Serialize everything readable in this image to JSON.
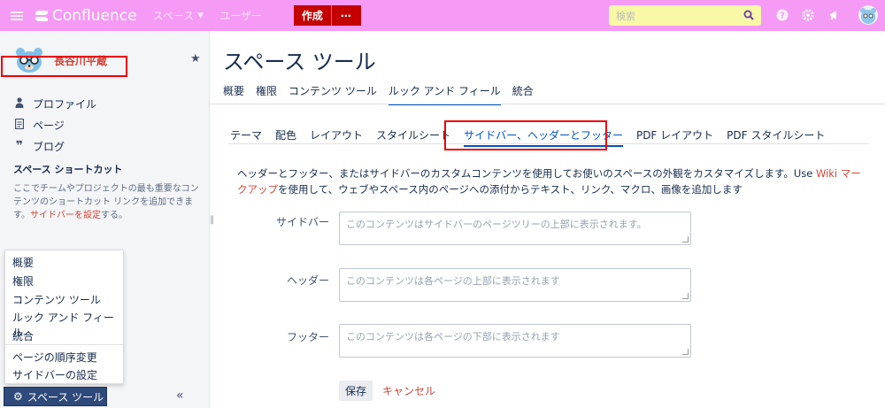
{
  "header": {
    "logo_text": "Confluence",
    "nav_spaces": "スペース",
    "nav_users": "ユーザー",
    "create_label": "作成",
    "more_label": "⋯",
    "search_placeholder": "検索",
    "colors": {
      "bar": "#f59af5",
      "create": "#c40000",
      "search_bg": "#f8f8a6"
    }
  },
  "sidebar": {
    "space_name": "長谷川平蔵",
    "links": [
      {
        "label": "プロファイル",
        "icon": "person-icon"
      },
      {
        "label": "ページ",
        "icon": "page-icon"
      },
      {
        "label": "ブログ",
        "icon": "quote-icon"
      }
    ],
    "shortcut_title": "スペース ショートカット",
    "shortcut_text_1": "ここでチームやプロジェクトの最も重要なコンテンツのショートカット リンクを追加できます。",
    "shortcut_link": "サイドバーを設定",
    "shortcut_text_2": "する。",
    "tool_button": "スペース ツール",
    "collapse_label": "«"
  },
  "popup": {
    "items": [
      "概要",
      "権限",
      "コンテンツ ツール",
      "ルック アンド フィール",
      "統合"
    ],
    "items2": [
      "ページの順序変更",
      "サイドバーの設定"
    ]
  },
  "main": {
    "title": "スペース ツール",
    "tabs": [
      "概要",
      "権限",
      "コンテンツ ツール",
      "ルック アンド フィール",
      "統合"
    ],
    "subtabs": [
      "テーマ",
      "配色",
      "レイアウト",
      "スタイルシート",
      "サイドバー、ヘッダーとフッター",
      "PDF レイアウト",
      "PDF スタイルシート"
    ],
    "desc_1": "ヘッダーとフッター、またはサイドバーのカスタムコンテンツを使用してお使いのスペースの外観をカスタマイズします。Use ",
    "desc_link": "Wiki マークアップ",
    "desc_2": "を使用して、ウェブやスペース内のページへの添付からテキスト、リンク、マクロ、画像を追加します",
    "fields": [
      {
        "label": "サイドバー",
        "placeholder": "このコンテンツはサイドバーのページツリーの上部に表示されます。"
      },
      {
        "label": "ヘッダー",
        "placeholder": "このコンテンツは各ページの上部に表示されます"
      },
      {
        "label": "フッター",
        "placeholder": "このコンテンツは各ページの下部に表示されます"
      }
    ],
    "save_label": "保存",
    "cancel_label": "キャンセル"
  }
}
